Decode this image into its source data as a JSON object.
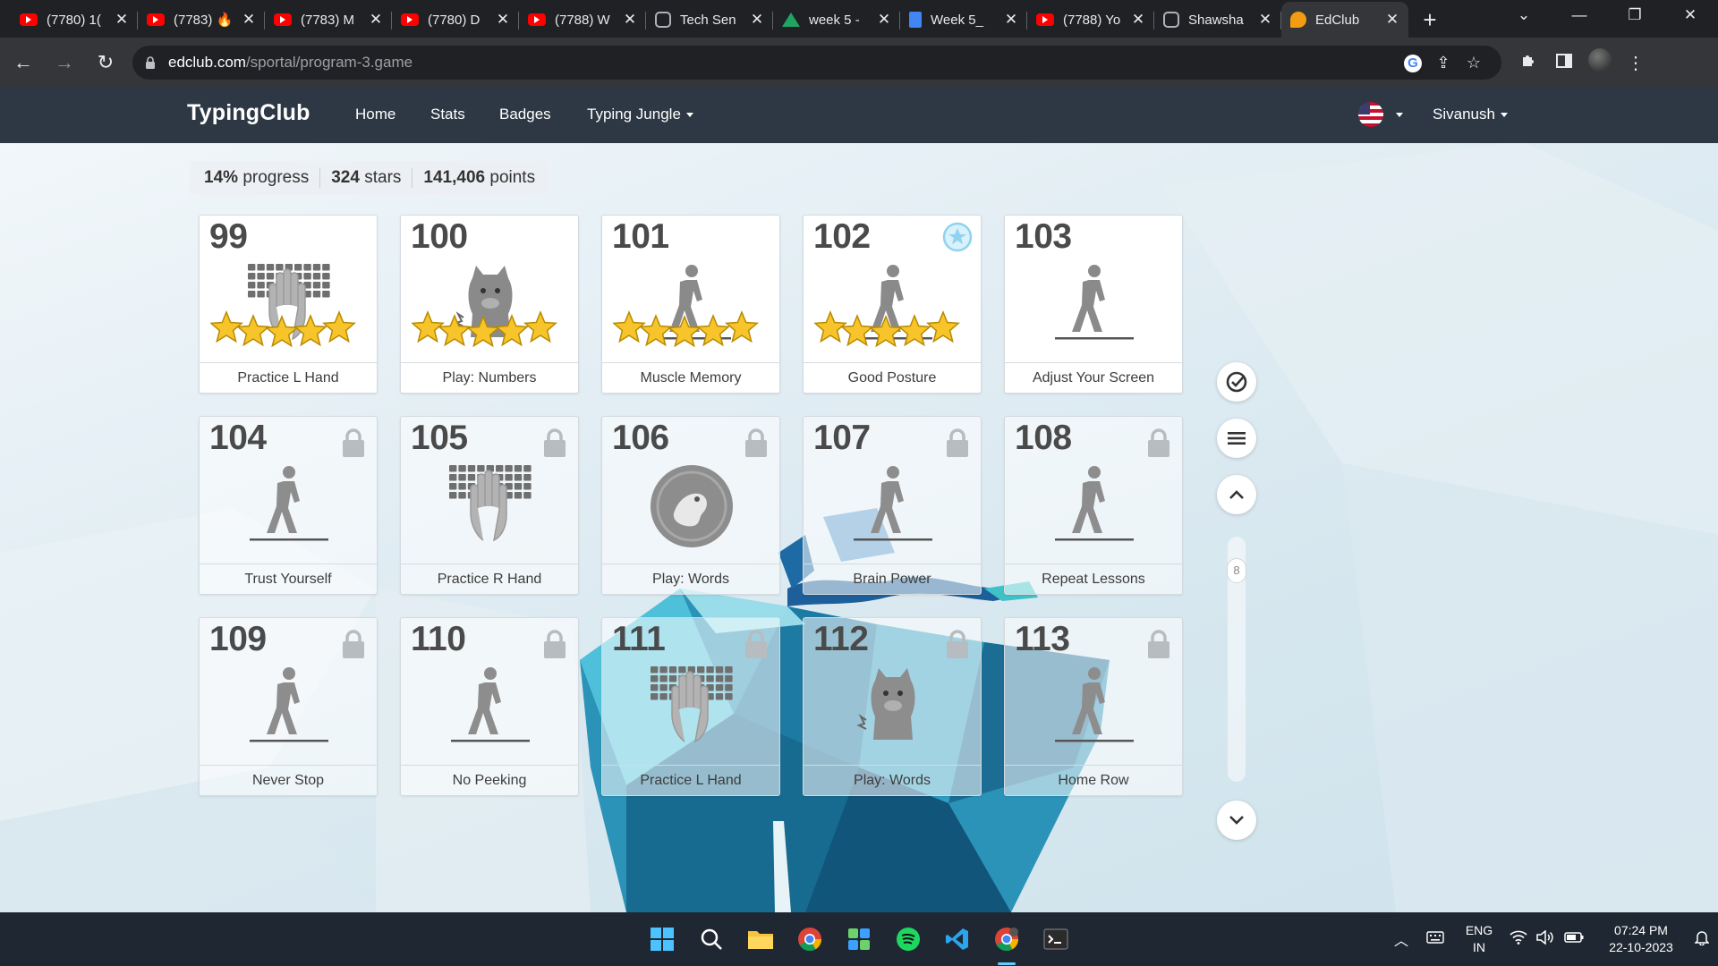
{
  "browser": {
    "tabs": [
      {
        "title": "(7780) 1(",
        "icon": "youtube-icon"
      },
      {
        "title": "(7783) 🔥",
        "icon": "youtube-icon"
      },
      {
        "title": "(7783) M",
        "icon": "youtube-icon"
      },
      {
        "title": "(7780) D",
        "icon": "youtube-icon"
      },
      {
        "title": "(7788) W",
        "icon": "youtube-icon"
      },
      {
        "title": "Tech Sen",
        "icon": "chatgpt-icon"
      },
      {
        "title": "week 5 -",
        "icon": "drive-icon"
      },
      {
        "title": "Week 5_",
        "icon": "docs-icon"
      },
      {
        "title": "(7788) Yo",
        "icon": "youtube-icon"
      },
      {
        "title": "Shawsha",
        "icon": "chatgpt-icon"
      },
      {
        "title": "EdClub",
        "icon": "edclub-icon"
      }
    ],
    "url_host": "edclub.com",
    "url_path": "/sportal/program-3.game"
  },
  "nav": {
    "brand": "TypingClub",
    "links": [
      "Home",
      "Stats",
      "Badges",
      "Typing Jungle"
    ],
    "user": "Sivanush"
  },
  "stats": {
    "progress_value": "14%",
    "progress_label": "progress",
    "stars_value": "324",
    "stars_label": "stars",
    "points_value": "141,406",
    "points_label": "points"
  },
  "lessons": [
    {
      "num": "99",
      "label": "Practice L Hand",
      "icon": "keyboard-hand-icon",
      "stars": 5,
      "locked": false
    },
    {
      "num": "100",
      "label": "Play: Numbers",
      "icon": "monster-icon",
      "stars": 5,
      "locked": false
    },
    {
      "num": "101",
      "label": "Muscle Memory",
      "icon": "walking-person-icon",
      "stars": 5,
      "locked": false
    },
    {
      "num": "102",
      "label": "Good Posture",
      "icon": "walking-person-icon",
      "stars": 5,
      "locked": false,
      "badge": true
    },
    {
      "num": "103",
      "label": "Adjust Your Screen",
      "icon": "walking-person-icon",
      "stars": 0,
      "locked": false
    },
    {
      "num": "104",
      "label": "Trust Yourself",
      "icon": "walking-person-icon",
      "stars": 0,
      "locked": true
    },
    {
      "num": "105",
      "label": "Practice R Hand",
      "icon": "keyboard-hand-icon",
      "stars": 0,
      "locked": true
    },
    {
      "num": "106",
      "label": "Play: Words",
      "icon": "game-disc-icon",
      "stars": 0,
      "locked": true
    },
    {
      "num": "107",
      "label": "Brain Power",
      "icon": "walking-person-icon",
      "stars": 0,
      "locked": true
    },
    {
      "num": "108",
      "label": "Repeat Lessons",
      "icon": "walking-person-icon",
      "stars": 0,
      "locked": true
    },
    {
      "num": "109",
      "label": "Never Stop",
      "icon": "walking-person-icon",
      "stars": 0,
      "locked": true
    },
    {
      "num": "110",
      "label": "No Peeking",
      "icon": "walking-person-icon",
      "stars": 0,
      "locked": true
    },
    {
      "num": "111",
      "label": "Practice L Hand",
      "icon": "keyboard-hand-icon",
      "stars": 0,
      "locked": true
    },
    {
      "num": "112",
      "label": "Play: Words",
      "icon": "monster-icon",
      "stars": 0,
      "locked": true
    },
    {
      "num": "113",
      "label": "Home Row",
      "icon": "walking-person-icon",
      "stars": 0,
      "locked": true
    }
  ],
  "side": {
    "scroll_page": "8"
  },
  "taskbar": {
    "lang_top": "ENG",
    "lang_bottom": "IN",
    "time": "07:24 PM",
    "date": "22-10-2023"
  },
  "colors": {
    "site_nav": "#2d3844",
    "star": "#f7c52b",
    "icon_gray": "#8a8a8a"
  }
}
